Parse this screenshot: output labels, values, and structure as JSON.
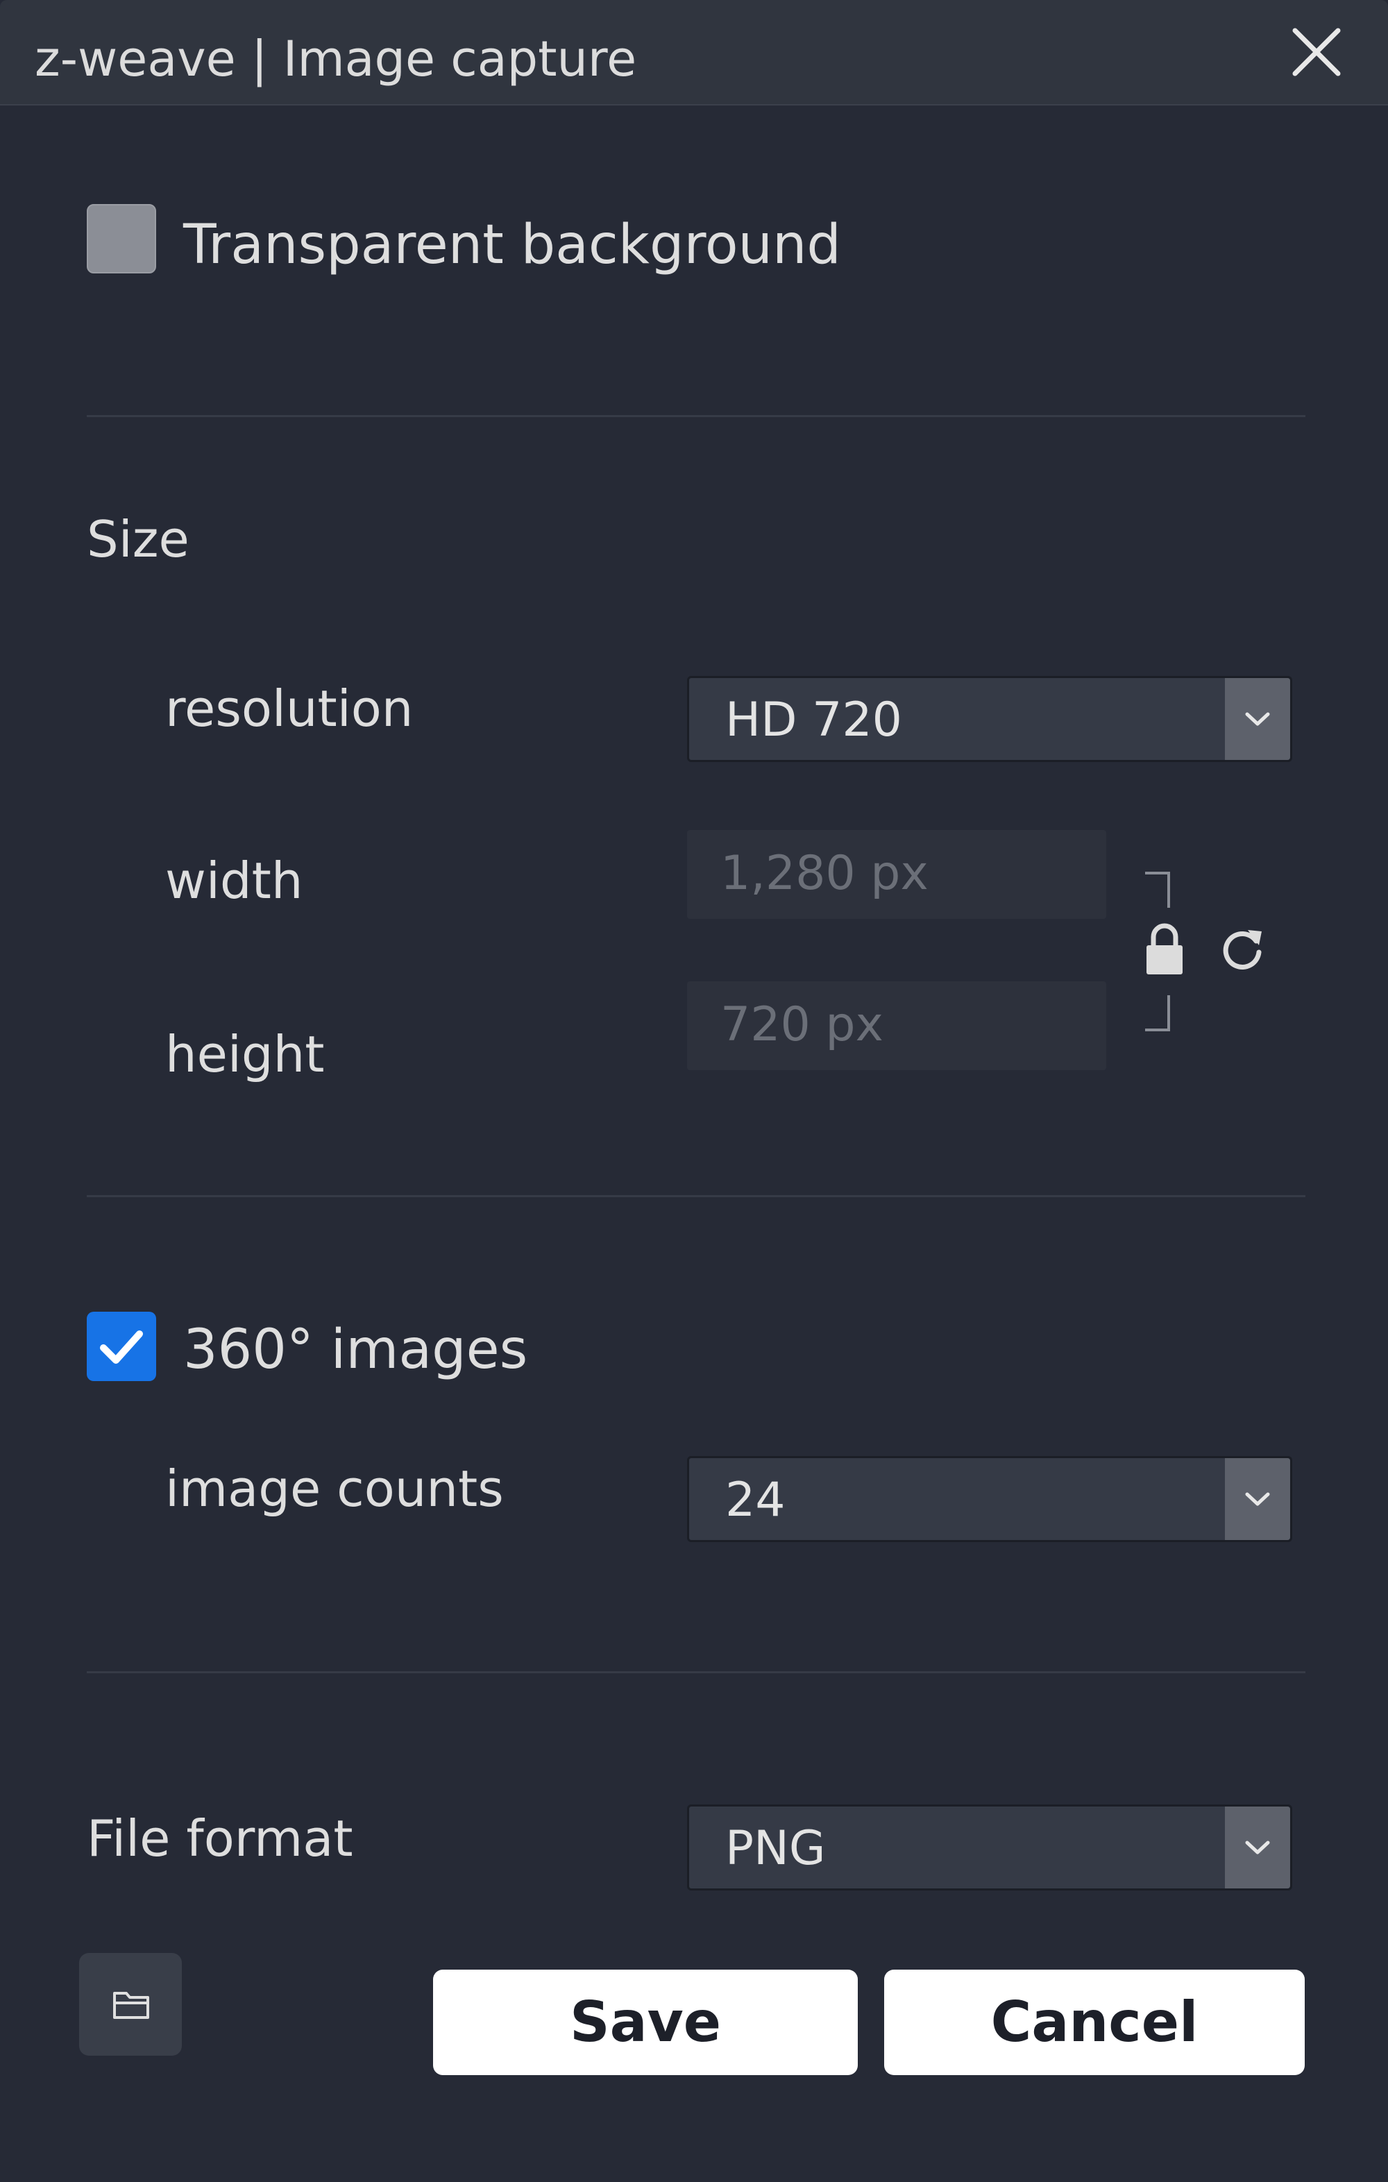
{
  "window": {
    "title": "z-weave | Image capture"
  },
  "options": {
    "transparent_background": {
      "label": "Transparent background",
      "checked": false
    }
  },
  "size": {
    "heading": "Size",
    "resolution_label": "resolution",
    "resolution_value": "HD 720",
    "width_label": "width",
    "width_value": "1,280 px",
    "height_label": "height",
    "height_value": "720 px",
    "aspect_locked": true
  },
  "images360": {
    "label": "360° images",
    "checked": true,
    "count_label": "image counts",
    "count_value": "24"
  },
  "format": {
    "label": "File format",
    "value": "PNG"
  },
  "actions": {
    "save_label": "Save",
    "cancel_label": "Cancel"
  },
  "icons": {
    "close": "close-icon",
    "chevron": "chevron-down-icon",
    "lock": "lock-icon",
    "reset": "reset-icon",
    "folder": "folder-icon",
    "check": "checkmark-icon"
  },
  "colors": {
    "background": "#262a36",
    "titlebar": "#30353f",
    "accent": "#1773e6",
    "button": "#ffffff"
  }
}
